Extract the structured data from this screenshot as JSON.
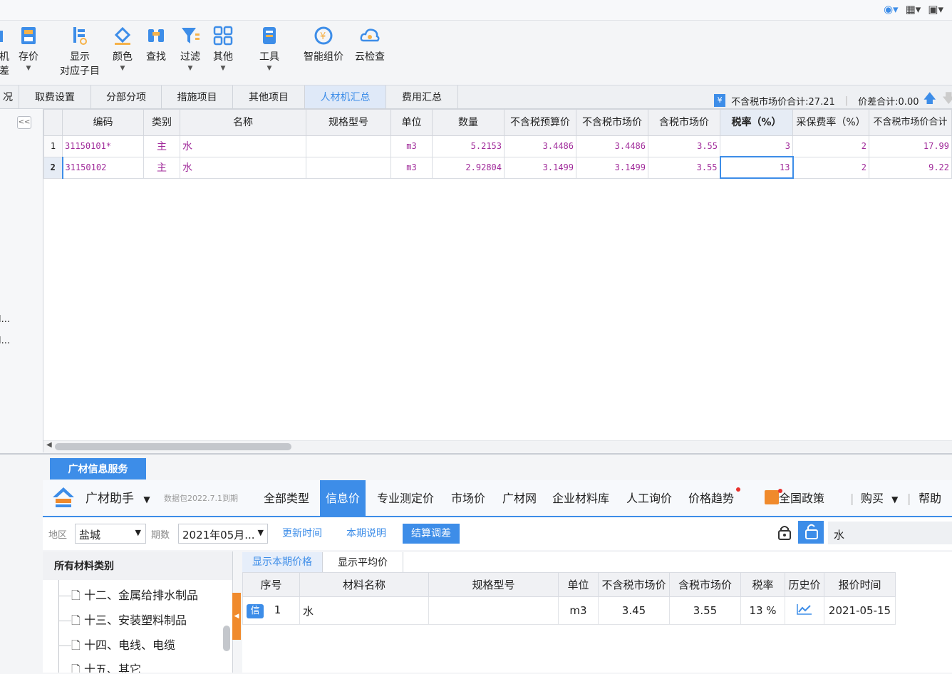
{
  "ribbon": {
    "items": [
      {
        "label": "机\n差",
        "name": "machine-diff"
      },
      {
        "label": "存价",
        "name": "save-price"
      },
      {
        "label": "显示\n对应子目",
        "name": "show-subitem"
      },
      {
        "label": "颜色",
        "name": "color"
      },
      {
        "label": "查找",
        "name": "find"
      },
      {
        "label": "过滤",
        "name": "filter"
      },
      {
        "label": "其他",
        "name": "other"
      },
      {
        "label": "工具",
        "name": "tools"
      },
      {
        "label": "智能组价",
        "name": "smart-price"
      },
      {
        "label": "云检查",
        "name": "cloud-check"
      }
    ],
    "item0_l1": "机",
    "item0_l2": "差",
    "item1": "存价",
    "item2_l1": "显示",
    "item2_l2": "对应子目",
    "item3": "颜色",
    "item4": "查找",
    "item5": "过滤",
    "item6": "其他",
    "item7": "工具",
    "item8": "智能组价",
    "item9": "云检查"
  },
  "tabs": {
    "partial": "况",
    "t1": "取费设置",
    "t2": "分部分项",
    "t3": "措施项目",
    "t4": "其他项目",
    "t5": "人材机汇总",
    "t6": "费用汇总"
  },
  "summary": {
    "market_total": "不含税市场价合计:27.21",
    "diff_total": "价差合计:0.00"
  },
  "left_truncated": [
    "l...",
    "l..."
  ],
  "grid": {
    "headers": [
      "编码",
      "类别",
      "名称",
      "规格型号",
      "单位",
      "数量",
      "不含税预算价",
      "不含税市场价",
      "含税市场价",
      "税率（%）",
      "采保费率（%）",
      "不含税市场价合计"
    ],
    "rows": [
      {
        "no": "1",
        "code": "31150101*",
        "type": "主",
        "name": "水",
        "spec": "",
        "unit": "m3",
        "qty": "5.2153",
        "budget": "3.4486",
        "market": "3.4486",
        "tax_market": "3.55",
        "rate": "3",
        "fee": "2",
        "total": "17.99"
      },
      {
        "no": "2",
        "code": "31150102",
        "type": "主",
        "name": "水",
        "spec": "",
        "unit": "m3",
        "qty": "2.92804",
        "budget": "3.1499",
        "market": "3.1499",
        "tax_market": "3.55",
        "rate": "13",
        "fee": "2",
        "total": "9.22"
      }
    ]
  },
  "bottom": {
    "service_tab": "广材信息服务",
    "assistant": "广材助手",
    "package": "数据包2022.7.1到期",
    "info_tabs": [
      "全部类型",
      "信息价",
      "专业测定价",
      "市场价",
      "广材网",
      "企业材料库",
      "人工询价",
      "价格趋势"
    ],
    "policy": "全国政策",
    "buy": "购买",
    "help": "帮助",
    "region_label": "地区",
    "region_value": "盐城",
    "period_label": "期数",
    "period_value": "2021年05月...",
    "update_time": "更新时间",
    "period_note": "本期说明",
    "settle_adjust": "结算调差",
    "search_value": "水",
    "category_header": "所有材料类别",
    "categories": [
      "十二、金属给排水制品",
      "十三、安装塑料制品",
      "十四、电线、电缆",
      "十五、其它"
    ],
    "sub_tabs": [
      "显示本期价格",
      "显示平均价"
    ],
    "price_headers": [
      "序号",
      "材料名称",
      "规格型号",
      "单位",
      "不含税市场价",
      "含税市场价",
      "税率",
      "历史价",
      "报价时间"
    ],
    "price_row": {
      "badge": "信",
      "no": "1",
      "name": "水",
      "spec": "",
      "unit": "m3",
      "market": "3.45",
      "tax_market": "3.55",
      "rate": "13 %",
      "date": "2021-05-15"
    }
  }
}
